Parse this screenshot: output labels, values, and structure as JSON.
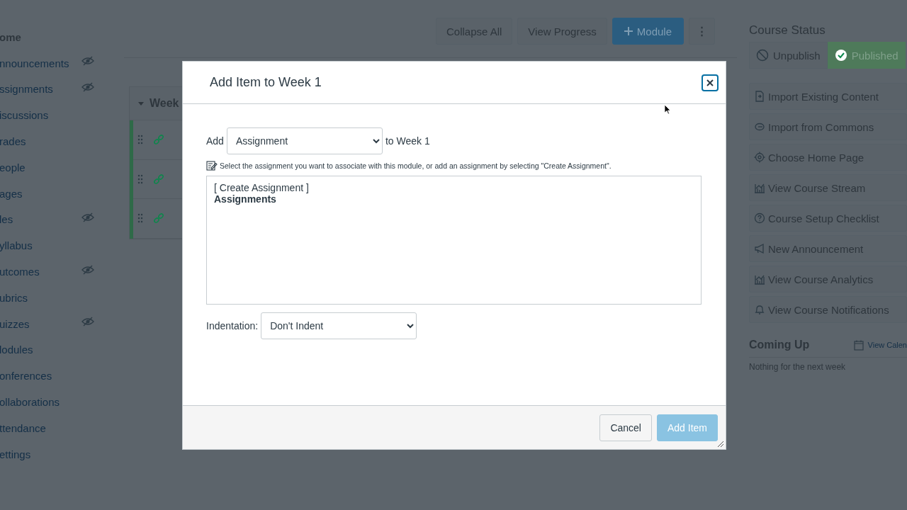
{
  "sidebar": {
    "items": [
      {
        "label": "ome",
        "hidden": false,
        "selected": true
      },
      {
        "label": "nnouncements",
        "hidden": true,
        "selected": false
      },
      {
        "label": "ssignments",
        "hidden": true,
        "selected": false
      },
      {
        "label": "iscussions",
        "hidden": false,
        "selected": false
      },
      {
        "label": "rades",
        "hidden": false,
        "selected": false
      },
      {
        "label": "eople",
        "hidden": false,
        "selected": false
      },
      {
        "label": "ages",
        "hidden": false,
        "selected": false
      },
      {
        "label": "les",
        "hidden": true,
        "selected": false
      },
      {
        "label": "yllabus",
        "hidden": false,
        "selected": false
      },
      {
        "label": "utcomes",
        "hidden": true,
        "selected": false
      },
      {
        "label": "ubrics",
        "hidden": false,
        "selected": false
      },
      {
        "label": "uizzes",
        "hidden": true,
        "selected": false
      },
      {
        "label": "lodules",
        "hidden": false,
        "selected": false
      },
      {
        "label": "onferences",
        "hidden": false,
        "selected": false
      },
      {
        "label": "ollaborations",
        "hidden": false,
        "selected": false
      },
      {
        "label": "ttendance",
        "hidden": false,
        "selected": false
      },
      {
        "label": "ettings",
        "hidden": false,
        "selected": false
      }
    ]
  },
  "toolbar": {
    "buttons": [
      {
        "label": "Collapse All",
        "kind": "plain"
      },
      {
        "label": "View Progress",
        "kind": "plain"
      },
      {
        "label": "Module",
        "kind": "primary"
      },
      {
        "label": "⋮",
        "kind": "more"
      }
    ]
  },
  "module": {
    "title": "Week",
    "expanded": true
  },
  "course_status": {
    "title": "Course Status",
    "buttons": [
      {
        "label": "Unpublish",
        "selected": false
      },
      {
        "label": "Published",
        "selected": true
      }
    ]
  },
  "actions": [
    {
      "label": "Import Existing Content"
    },
    {
      "label": "Import from Commons"
    },
    {
      "label": "Choose Home Page"
    },
    {
      "label": "View Course Stream"
    },
    {
      "label": "Course Setup Checklist"
    },
    {
      "label": "New Announcement"
    },
    {
      "label": "View Course Analytics"
    },
    {
      "label": "View Course Notifications"
    }
  ],
  "coming_up": {
    "title": "Coming Up",
    "link": "View Calen",
    "empty_text": "Nothing for the next week"
  },
  "dialog": {
    "title": "Add Item to Week 1",
    "add_label": "Add",
    "type_value": "Assignment",
    "target_label": "to Week 1",
    "hint": "Select the assignment you want to associate with this module, or add an assignment by selecting \"Create Assignment\".",
    "list": [
      {
        "text": "[ Create Assignment ]",
        "kind": "option"
      },
      {
        "text": "Assignments",
        "kind": "group"
      }
    ],
    "indent_label": "Indentation:",
    "indent_value": "Don't Indent",
    "buttons": [
      {
        "label": "Cancel",
        "kind": "secondary",
        "disabled": false
      },
      {
        "label": "Add Item",
        "kind": "primary",
        "disabled": true
      }
    ]
  }
}
